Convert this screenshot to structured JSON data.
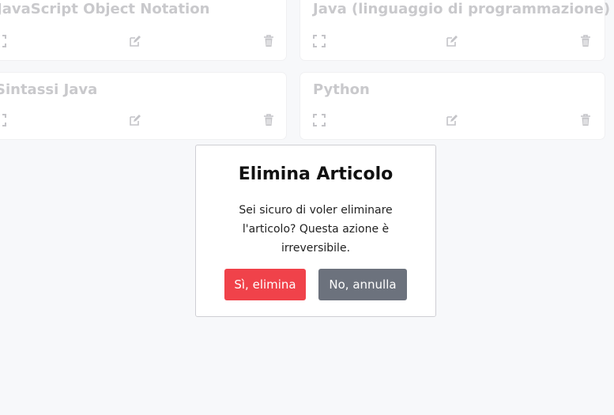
{
  "articles": [
    {
      "title": "JavaScript Object Notation"
    },
    {
      "title": "Java (linguaggio di programmazione)"
    },
    {
      "title": "Sintassi Java"
    },
    {
      "title": "Python"
    }
  ],
  "icons": {
    "expand": "expand-icon",
    "edit": "edit-icon",
    "delete": "trash-icon"
  },
  "modal": {
    "title": "Elimina Articolo",
    "message": "Sei sicuro di voler eliminare l'articolo? Questa azione è irreversibile.",
    "confirm_label": "Sì, elimina",
    "cancel_label": "No, annulla"
  },
  "colors": {
    "danger": "#f0424a",
    "secondary": "#6c727d"
  }
}
